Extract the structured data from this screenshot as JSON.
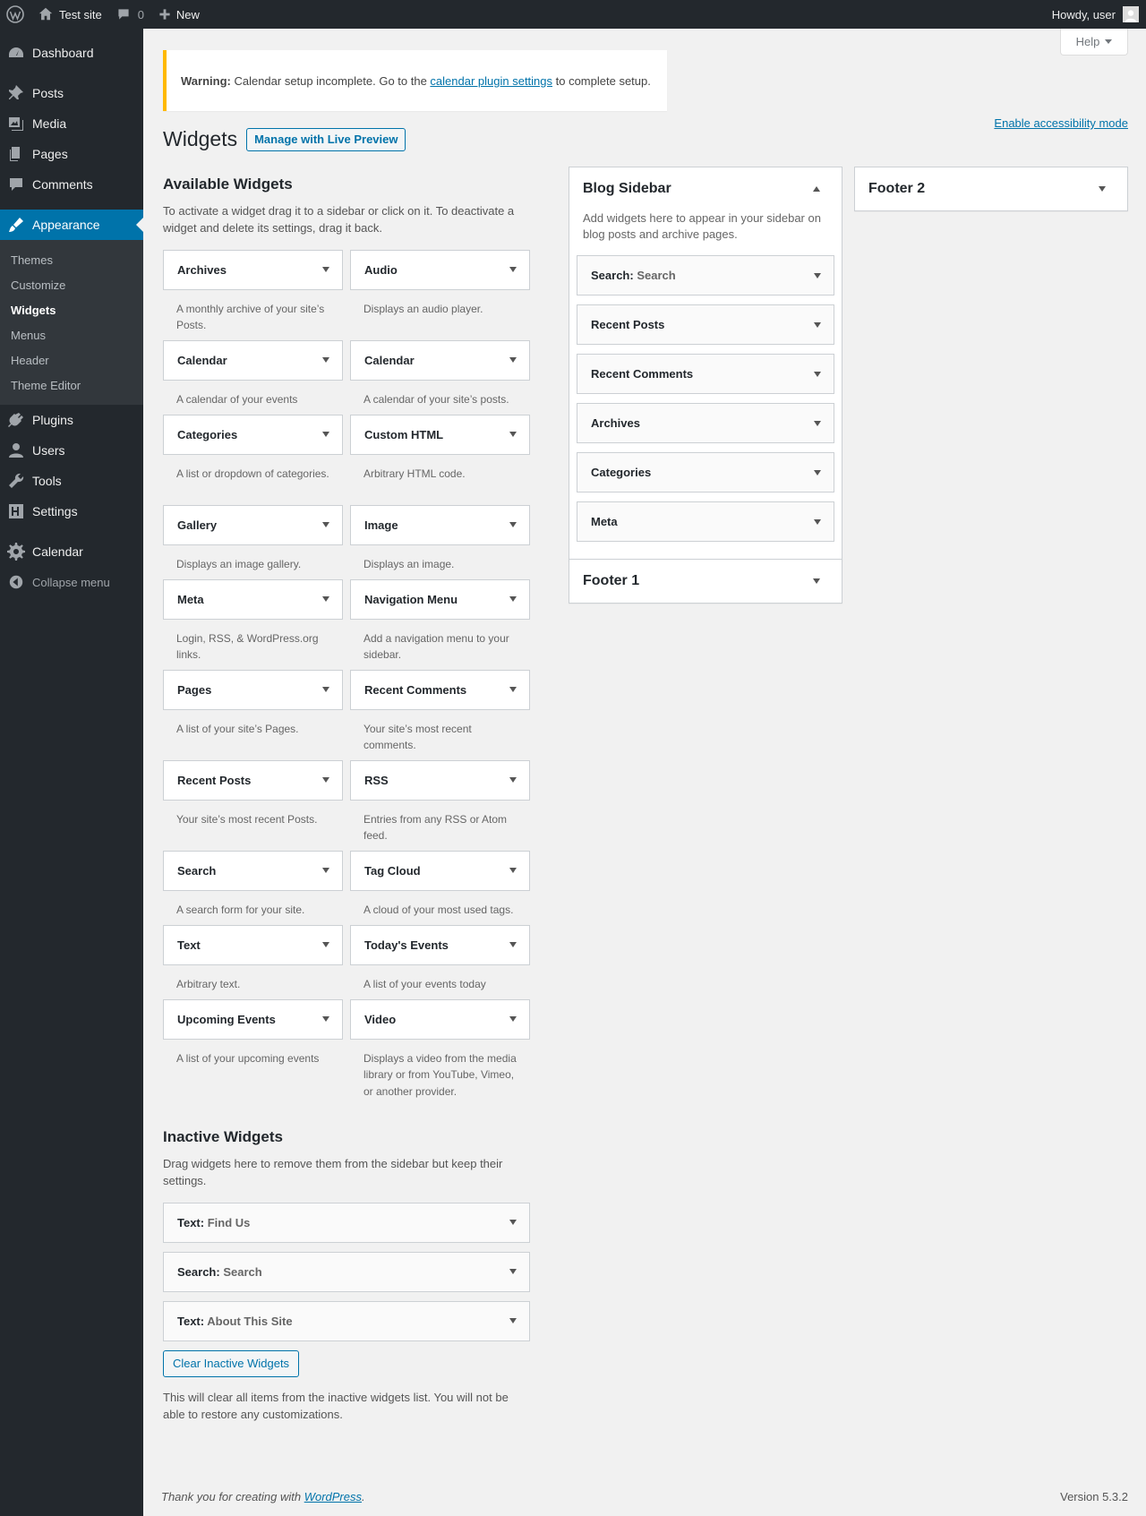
{
  "adminbar": {
    "site_name": "Test site",
    "comments_count": "0",
    "new_label": "New",
    "howdy": "Howdy, user"
  },
  "menu": {
    "dashboard": "Dashboard",
    "posts": "Posts",
    "media": "Media",
    "pages": "Pages",
    "comments": "Comments",
    "appearance": "Appearance",
    "sub": [
      "Themes",
      "Customize",
      "Widgets",
      "Menus",
      "Header",
      "Theme Editor"
    ],
    "plugins": "Plugins",
    "users": "Users",
    "tools": "Tools",
    "settings": "Settings",
    "calendar": "Calendar",
    "collapse": "Collapse menu"
  },
  "help_label": "Help",
  "notice": {
    "strong": "Warning:",
    "text_before": " Calendar setup incomplete. Go to the ",
    "link": "calendar plugin settings",
    "text_after": " to complete setup."
  },
  "accessibility_link": "Enable accessibility mode",
  "page": {
    "title": "Widgets",
    "live_preview": "Manage with Live Preview"
  },
  "available": {
    "title": "Available Widgets",
    "desc": "To activate a widget drag it to a sidebar or click on it. To deactivate a widget and delete its settings, drag it back.",
    "widgets": [
      {
        "name": "Archives",
        "desc": "A monthly archive of your site’s Posts."
      },
      {
        "name": "Audio",
        "desc": "Displays an audio player."
      },
      {
        "name": "Calendar",
        "desc": "A calendar of your events"
      },
      {
        "name": "Calendar",
        "desc": "A calendar of your site’s posts."
      },
      {
        "name": "Categories",
        "desc": "A list or dropdown of categories."
      },
      {
        "name": "Custom HTML",
        "desc": "Arbitrary HTML code."
      },
      {
        "name": "Gallery",
        "desc": "Displays an image gallery."
      },
      {
        "name": "Image",
        "desc": "Displays an image."
      },
      {
        "name": "Meta",
        "desc": "Login, RSS, & WordPress.org links."
      },
      {
        "name": "Navigation Menu",
        "desc": "Add a navigation menu to your sidebar."
      },
      {
        "name": "Pages",
        "desc": "A list of your site’s Pages."
      },
      {
        "name": "Recent Comments",
        "desc": "Your site’s most recent comments."
      },
      {
        "name": "Recent Posts",
        "desc": "Your site’s most recent Posts."
      },
      {
        "name": "RSS",
        "desc": "Entries from any RSS or Atom feed."
      },
      {
        "name": "Search",
        "desc": "A search form for your site."
      },
      {
        "name": "Tag Cloud",
        "desc": "A cloud of your most used tags."
      },
      {
        "name": "Text",
        "desc": "Arbitrary text."
      },
      {
        "name": "Today's Events",
        "desc": "A list of your events today"
      },
      {
        "name": "Upcoming Events",
        "desc": "A list of your upcoming events"
      },
      {
        "name": "Video",
        "desc": "Displays a video from the media library or from YouTube, Vimeo, or another provider."
      }
    ]
  },
  "inactive": {
    "title": "Inactive Widgets",
    "desc": "Drag widgets here to remove them from the sidebar but keep their settings.",
    "widgets": [
      {
        "name": "Text:",
        "title": " Find Us"
      },
      {
        "name": "Search:",
        "title": " Search"
      },
      {
        "name": "Text:",
        "title": " About This Site"
      }
    ],
    "clear_button": "Clear Inactive Widgets",
    "clear_note": "This will clear all items from the inactive widgets list. You will not be able to restore any customizations."
  },
  "blog_sidebar": {
    "title": "Blog Sidebar",
    "desc": "Add widgets here to appear in your sidebar on blog posts and archive pages.",
    "widgets": [
      {
        "name": "Search:",
        "title": " Search"
      },
      {
        "name": "Recent Posts",
        "title": ""
      },
      {
        "name": "Recent Comments",
        "title": ""
      },
      {
        "name": "Archives",
        "title": ""
      },
      {
        "name": "Categories",
        "title": ""
      },
      {
        "name": "Meta",
        "title": ""
      }
    ]
  },
  "footer1": {
    "title": "Footer 1"
  },
  "footer2": {
    "title": "Footer 2"
  },
  "footer": {
    "thanks_before": "Thank you for creating with ",
    "thanks_link": "WordPress",
    "thanks_after": ".",
    "version": "Version 5.3.2"
  }
}
